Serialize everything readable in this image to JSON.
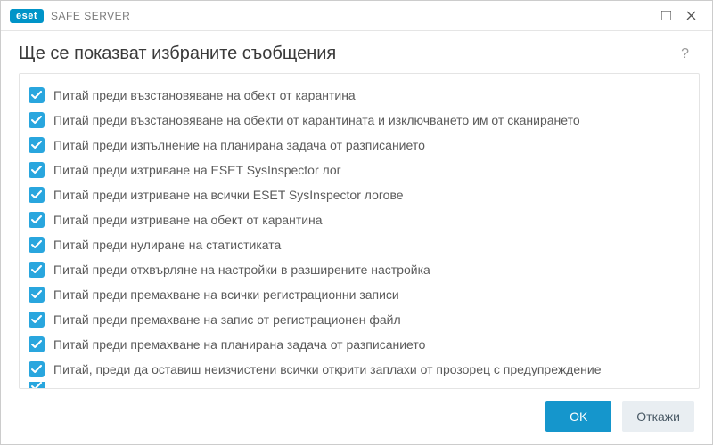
{
  "brand": {
    "badge": "eset",
    "product": "SAFE SERVER"
  },
  "header": {
    "title": "Ще се показват избраните съобщения"
  },
  "list": {
    "items": [
      {
        "checked": true,
        "label": "Питай преди възстановяване на обект от карантина"
      },
      {
        "checked": true,
        "label": "Питай преди възстановяване на обекти от карантината и изключването им от сканирането"
      },
      {
        "checked": true,
        "label": "Питай преди изпълнение на планирана задача от разписанието"
      },
      {
        "checked": true,
        "label": "Питай преди изтриване на ESET SysInspector лог"
      },
      {
        "checked": true,
        "label": "Питай преди изтриване на всички ESET SysInspector логове"
      },
      {
        "checked": true,
        "label": "Питай преди изтриване на обект от карантина"
      },
      {
        "checked": true,
        "label": "Питай преди нулиране на статистиката"
      },
      {
        "checked": true,
        "label": "Питай преди отхвърляне на настройки в разширените настройка"
      },
      {
        "checked": true,
        "label": "Питай преди премахване на всички регистрационни записи"
      },
      {
        "checked": true,
        "label": "Питай преди премахване на запис от регистрационен файл"
      },
      {
        "checked": true,
        "label": "Питай преди премахване на планирана задача от разписанието"
      },
      {
        "checked": true,
        "label": "Питай, преди да оставиш неизчистени всички открити заплахи от прозорец с предупреждение"
      },
      {
        "checked": true,
        "label": ""
      }
    ]
  },
  "footer": {
    "ok": "OK",
    "cancel": "Откажи"
  },
  "colors": {
    "accent": "#1596cc",
    "checkbox": "#29a6de"
  }
}
